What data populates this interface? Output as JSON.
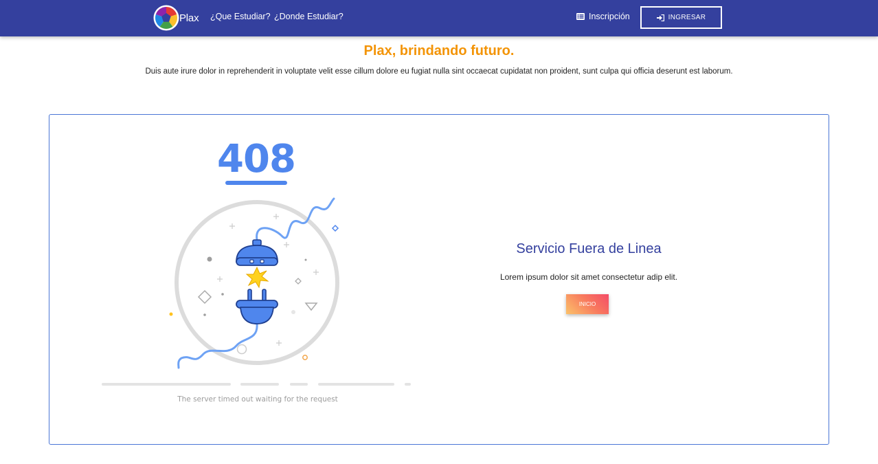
{
  "navbar": {
    "brand": "Plax",
    "links": [
      "¿Que Estudiar?",
      "¿Donde Estudiar?"
    ],
    "inscripcion": "Inscripción",
    "ingresar": "INGRESAR",
    "background_color": "#34409e"
  },
  "hero": {
    "title": "Plax, brindando futuro.",
    "text": "Duis aute irure dolor in reprehenderit in voluptate velit esse cillum dolore eu fugiat nulla sint occaecat cupidatat non proident, sunt culpa qui officia deserunt est laborum.",
    "title_color": "#f39406"
  },
  "error": {
    "code": "408",
    "caption": "The server timed out waiting for the request",
    "heading": "Servicio Fuera de Linea",
    "message": "Lorem ipsum dolor sit amet consectetur adip elit.",
    "button": "INICIO",
    "accent_color": "#4f86ed"
  },
  "icons": {
    "logo": "plax-logo-icon",
    "inscripcion": "list-icon",
    "ingresar": "sign-in-icon",
    "illustration": "unplugged-plug-icon"
  }
}
